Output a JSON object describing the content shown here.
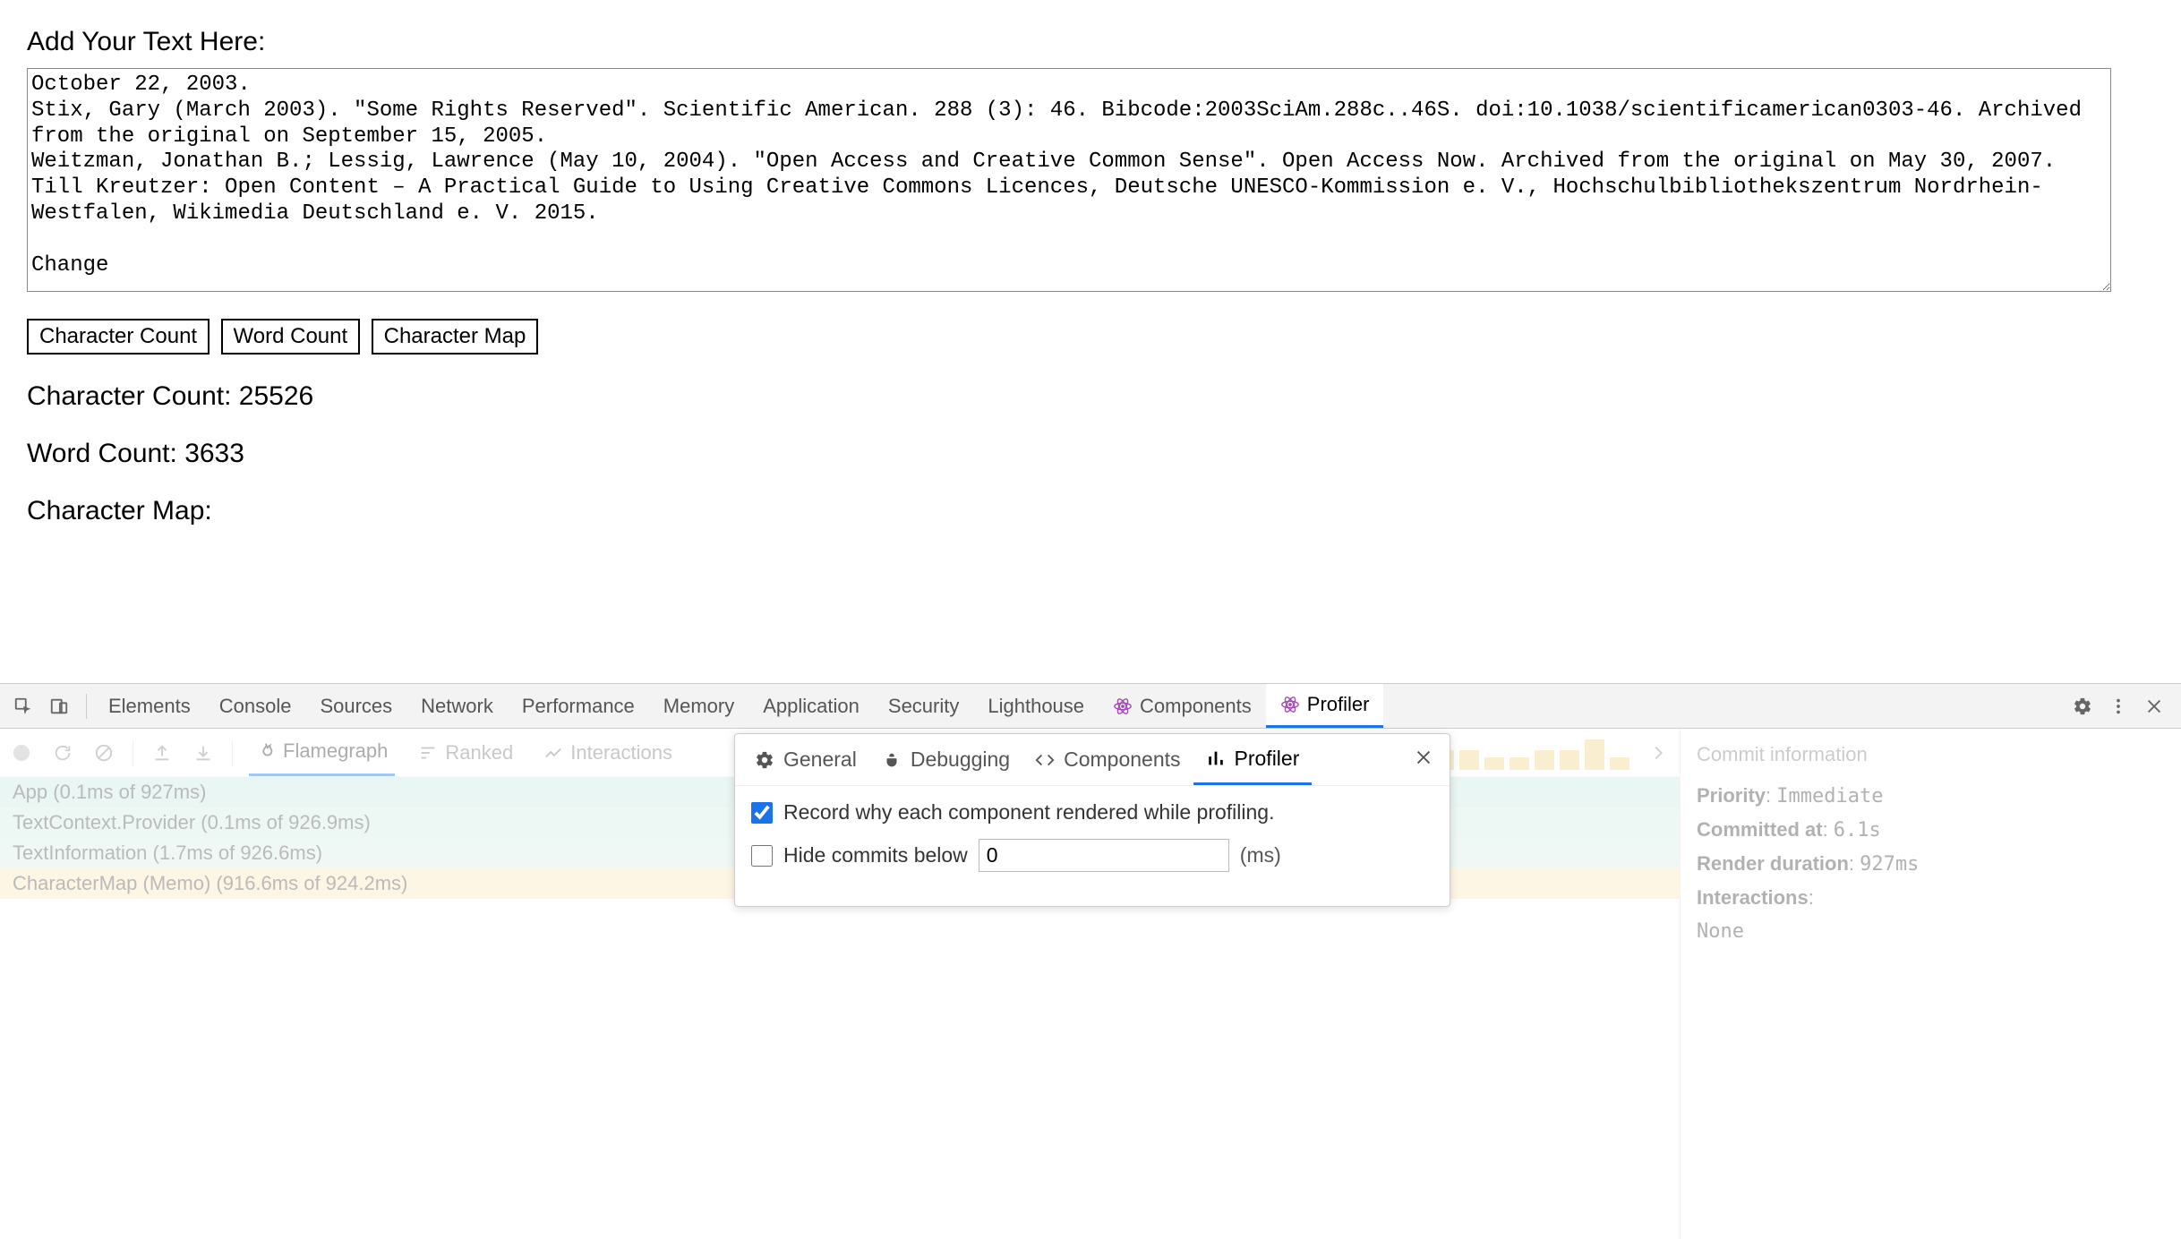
{
  "page": {
    "heading": "Add Your Text Here:",
    "textarea_value": "October 22, 2003.\nStix, Gary (March 2003). \"Some Rights Reserved\". Scientific American. 288 (3): 46. Bibcode:2003SciAm.288c..46S. doi:10.1038/scientificamerican0303-46. Archived from the original on September 15, 2005.\nWeitzman, Jonathan B.; Lessig, Lawrence (May 10, 2004). \"Open Access and Creative Common Sense\". Open Access Now. Archived from the original on May 30, 2007.\nTill Kreutzer: Open Content – A Practical Guide to Using Creative Commons Licences, Deutsche UNESCO-Kommission e. V., Hochschulbibliothekszentrum Nordrhein-Westfalen, Wikimedia Deutschland e. V. 2015.\n\nChange",
    "buttons": {
      "char_count": "Character Count",
      "word_count": "Word Count",
      "char_map": "Character Map"
    },
    "stats": {
      "char_count_label": "Character Count: 25526",
      "word_count_label": "Word Count: 3633",
      "char_map_label": "Character Map:"
    }
  },
  "devtools": {
    "tabs": [
      "Elements",
      "Console",
      "Sources",
      "Network",
      "Performance",
      "Memory",
      "Application",
      "Security",
      "Lighthouse",
      "Components",
      "Profiler"
    ],
    "active_tab": "Profiler"
  },
  "profiler": {
    "toolbar_tabs": {
      "flamegraph": "Flamegraph",
      "ranked": "Ranked",
      "interactions": "Interactions"
    },
    "flame_rows": [
      "App (0.1ms of 927ms)",
      "TextContext.Provider (0.1ms of 926.9ms)",
      "TextInformation (1.7ms of 926.6ms)",
      "CharacterMap (Memo) (916.6ms of 924.2ms)"
    ],
    "right_panel": {
      "title": "Commit information",
      "priority_label": "Priority",
      "priority_value": "Immediate",
      "committed_label": "Committed at",
      "committed_value": "6.1s",
      "render_label": "Render duration",
      "render_value": "927ms",
      "interactions_label": "Interactions",
      "interactions_value": "None"
    }
  },
  "settings": {
    "tabs": {
      "general": "General",
      "debugging": "Debugging",
      "components": "Components",
      "profiler": "Profiler"
    },
    "record_why_label": "Record why each component rendered while profiling.",
    "record_why_checked": true,
    "hide_commits_label": "Hide commits below",
    "hide_commits_value": "0",
    "hide_commits_checked": false,
    "units": "(ms)"
  }
}
